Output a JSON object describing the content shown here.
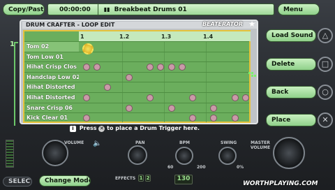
{
  "top": {
    "copy_paste": "Copy/Paste",
    "time": "00:00:00",
    "pause_icon": "pause-icon",
    "song": "Breakbeat Drums 01",
    "menu": "Menu"
  },
  "panel": {
    "title": "DRUM CRAFTER - LOOP EDIT",
    "brand": "BEATERATOR",
    "ruler": [
      "1",
      "1.2",
      "1.3",
      "1.4"
    ],
    "rows": [
      {
        "name": "Tom 02",
        "hits": []
      },
      {
        "name": "Tom Low 01",
        "hits": []
      },
      {
        "name": "Hihat Crisp Clos",
        "hits": [
          0,
          1,
          6,
          7,
          8,
          9
        ]
      },
      {
        "name": "Handclap Low 02",
        "hits": [
          4
        ]
      },
      {
        "name": "Hihat Distorted",
        "hits": [
          2
        ]
      },
      {
        "name": "Hihat Distorted",
        "hits": [
          0,
          6,
          10,
          14,
          15
        ]
      },
      {
        "name": "Snare Crisp 06",
        "hits": [
          4,
          8,
          12
        ]
      },
      {
        "name": "Kick Clear 01",
        "hits": [
          0,
          10,
          12,
          14
        ]
      }
    ]
  },
  "track_number": "1",
  "hint": {
    "info_icon": "info-icon",
    "text_before": "Press",
    "x_icon": "cross-icon",
    "text_after": "to place a Drum Trigger here."
  },
  "side": {
    "load": "Load Sound",
    "delete": "Delete",
    "back": "Back",
    "place": "Place",
    "ps_icons": [
      "triangle-icon",
      "square-icon",
      "circle-icon",
      "cross-icon"
    ]
  },
  "bottom": {
    "select": "SELECT",
    "change_mode": "Change Mode",
    "volume": "VOLUME",
    "pan": "PAN",
    "effects": "EFFECTS",
    "effects_values": [
      "1",
      "2"
    ],
    "bpm": "BPM",
    "bpm_value": "130",
    "swing": "SWING",
    "master_volume": "MASTER VOLUME",
    "bpm_ticks": [
      "60",
      "200"
    ],
    "swing_ticks": [
      "0%"
    ],
    "watermark": "WORTHPLAYING.COM"
  }
}
